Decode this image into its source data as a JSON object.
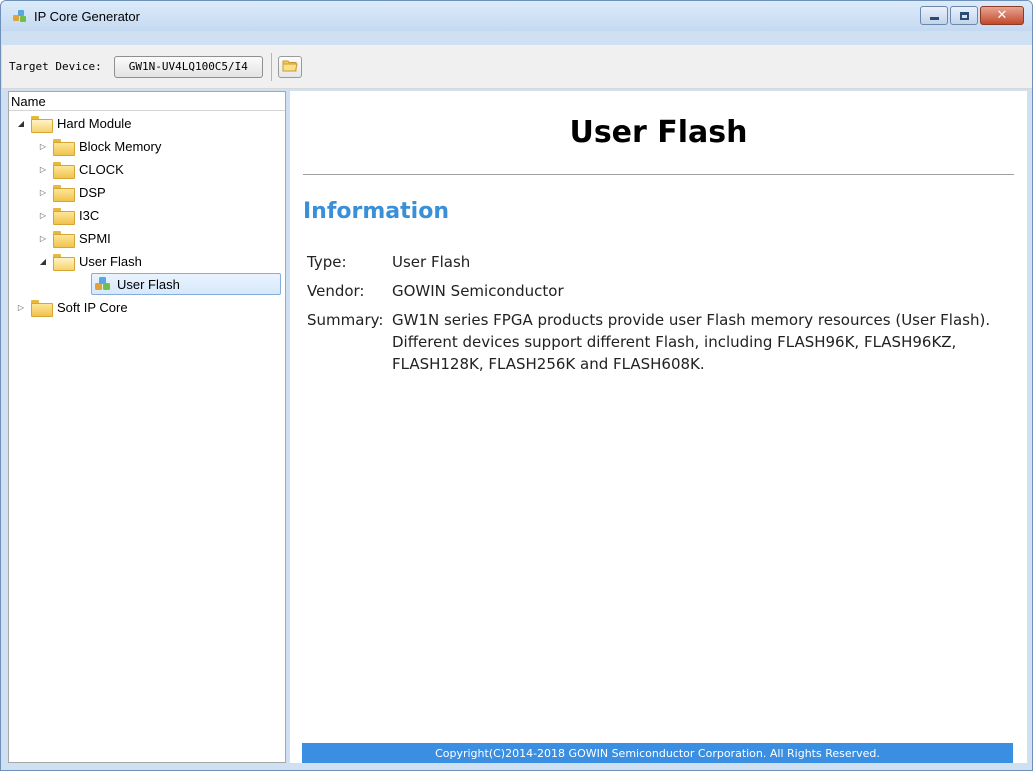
{
  "window": {
    "title": "IP Core Generator",
    "icon": "ip-core-generator-icon"
  },
  "toolbar": {
    "target_label": "Target Device:",
    "target_device": "GW1N-UV4LQ100C5/I4",
    "open_icon": "folder-open-icon"
  },
  "tree": {
    "header": "Name",
    "items": [
      {
        "label": "Hard Module",
        "expanded": true,
        "level": 0
      },
      {
        "label": "Block Memory",
        "expanded": false,
        "level": 1
      },
      {
        "label": "CLOCK",
        "expanded": false,
        "level": 1
      },
      {
        "label": "DSP",
        "expanded": false,
        "level": 1
      },
      {
        "label": "I3C",
        "expanded": false,
        "level": 1
      },
      {
        "label": "SPMI",
        "expanded": false,
        "level": 1
      },
      {
        "label": "User Flash",
        "expanded": true,
        "level": 1
      },
      {
        "label": "User Flash",
        "selected": true,
        "level": 2
      },
      {
        "label": "Soft IP Core",
        "expanded": false,
        "level": 0
      }
    ]
  },
  "content": {
    "title": "User Flash",
    "section": "Information",
    "info": [
      {
        "key": "Type:",
        "value": "User Flash"
      },
      {
        "key": "Vendor:",
        "value": "GOWIN Semiconductor"
      },
      {
        "key": "Summary:",
        "value": "GW1N series FPGA products provide user Flash memory resources (User Flash). Different devices support different Flash, including FLASH96K, FLASH96KZ, FLASH128K, FLASH256K and FLASH608K."
      }
    ],
    "footer": "Copyright(C)2014-2018 GOWIN Semiconductor Corporation. All Rights Reserved."
  },
  "colors": {
    "accent": "#3a8fd9",
    "footer_bg": "#3a8fe3",
    "selection_border": "#84acdd"
  }
}
